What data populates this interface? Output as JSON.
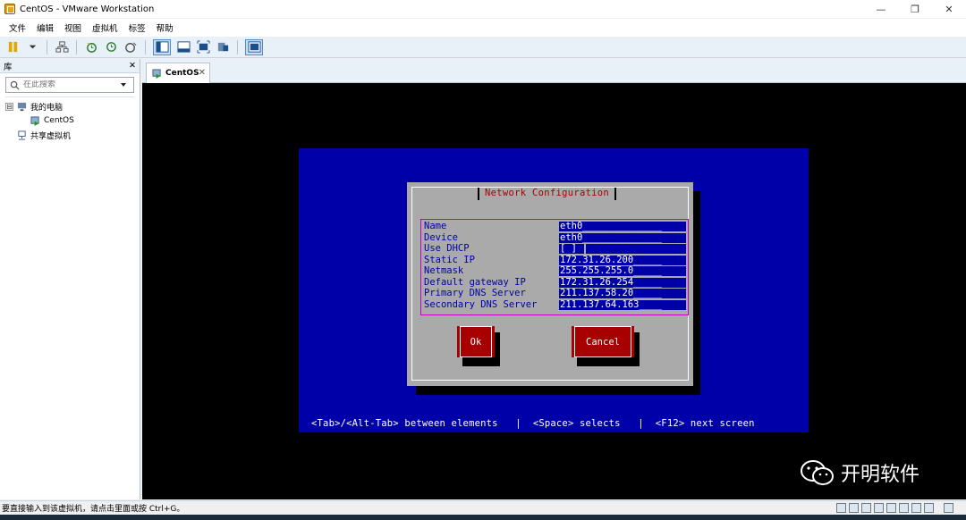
{
  "window": {
    "title": "CentOS - VMware Workstation",
    "minimize": "—",
    "restore": "❐",
    "close": "✕"
  },
  "menu": [
    "文件",
    "编辑",
    "视图",
    "虚拟机",
    "标签",
    "帮助"
  ],
  "library": {
    "title": "库",
    "close": "✕",
    "search_placeholder": "在此搜索",
    "tree": {
      "root_toggle": "⊟",
      "root_label": "我的电脑",
      "vm_label": "CentOS",
      "shared_label": "共享虚拟机"
    }
  },
  "tab": {
    "label": "CentOS",
    "close": "✕"
  },
  "console": {
    "dialog_title": "Network Configuration",
    "fields": [
      {
        "label": "Name",
        "value": "eth0______________"
      },
      {
        "label": "Device",
        "value": "eth0______________"
      },
      {
        "label": "Use DHCP",
        "value": "[ ]"
      },
      {
        "label": "Static IP",
        "value": "172.31.26.200_____"
      },
      {
        "label": "Netmask",
        "value": "255.255.255.0_____"
      },
      {
        "label": "Default gateway IP",
        "value": "172.31.26.254_____"
      },
      {
        "label": "Primary DNS Server",
        "value": "211.137.58.20_____"
      },
      {
        "label": "Secondary DNS Server",
        "value": "211.137.64.163____"
      }
    ],
    "ok_label": "Ok",
    "cancel_label": "Cancel",
    "hint": "<Tab>/<Alt-Tab> between elements   |  <Space> selects   |  <F12> next screen"
  },
  "watermark": {
    "text": "开明软件"
  },
  "status": {
    "text": "要直接输入到该虚拟机，请点击里面或按 Ctrl+G。"
  },
  "colors": {
    "console_bg": "#0000a8",
    "dialog_bg": "#aaaaaa",
    "title_red": "#a80000",
    "button_red": "#a80000"
  }
}
